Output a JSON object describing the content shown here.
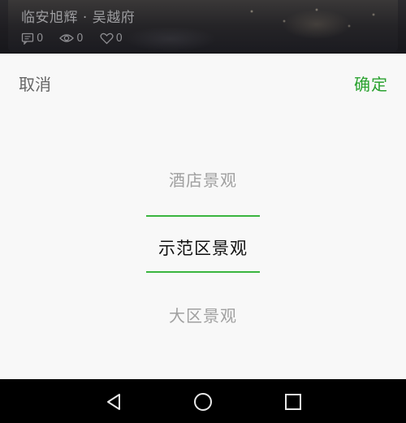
{
  "background_card": {
    "title": "临安旭辉 · 吴越府",
    "stats": [
      {
        "icon": "comment-icon",
        "count": "0"
      },
      {
        "icon": "eye-icon",
        "count": "0"
      },
      {
        "icon": "heart-icon",
        "count": "0"
      }
    ]
  },
  "sheet": {
    "cancel_label": "取消",
    "confirm_label": "确定",
    "accent_color": "#2aa22f",
    "picker": {
      "options": [
        "酒店景观",
        "示范区景观",
        "大区景观"
      ],
      "selected": "示范区景观"
    }
  },
  "navbar": {
    "buttons": [
      "back-icon",
      "home-icon",
      "recent-apps-icon"
    ]
  }
}
